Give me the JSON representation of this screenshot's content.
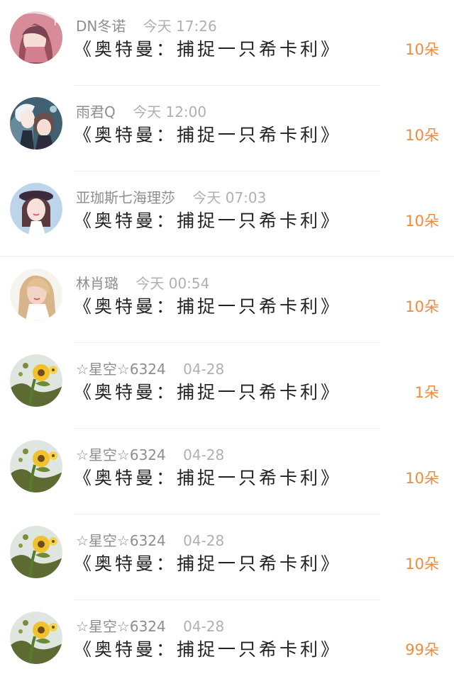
{
  "gift_list": [
    {
      "username": "DN冬诺",
      "time": "今天 17:26",
      "gift": "《奥特曼：捕捉一只希卡利》",
      "amount": "10朵",
      "avatar": "red-hood-girl-avatar"
    },
    {
      "username": "雨君Q",
      "time": "今天 12:00",
      "gift": "《奥特曼：捕捉一只希卡利》",
      "amount": "10朵",
      "avatar": "anime-characters-avatar"
    },
    {
      "username": "亚珈斯七海理莎",
      "time": "今天 07:03",
      "gift": "《奥特曼：捕捉一只希卡利》",
      "amount": "10朵",
      "avatar": "beret-girl-avatar"
    },
    {
      "username": "林肖璐",
      "time": "今天 00:54",
      "gift": "《奥特曼：捕捉一只希卡利》",
      "amount": "10朵",
      "avatar": "blonde-woman-avatar"
    },
    {
      "username": "☆星空☆6324",
      "time": "04-28",
      "gift": "《奥特曼：捕捉一只希卡利》",
      "amount": "1朵",
      "avatar": "sunflower-avatar"
    },
    {
      "username": "☆星空☆6324",
      "time": "04-28",
      "gift": "《奥特曼：捕捉一只希卡利》",
      "amount": "10朵",
      "avatar": "sunflower-avatar"
    },
    {
      "username": "☆星空☆6324",
      "time": "04-28",
      "gift": "《奥特曼：捕捉一只希卡利》",
      "amount": "10朵",
      "avatar": "sunflower-avatar"
    },
    {
      "username": "☆星空☆6324",
      "time": "04-28",
      "gift": "《奥特曼：捕捉一只希卡利》",
      "amount": "99朵",
      "avatar": "sunflower-avatar"
    }
  ],
  "colors": {
    "accent": "#f08b3c",
    "username": "#8e8e8e",
    "time": "#b0b0b0",
    "gift_text": "#222222",
    "divider": "#f0f0f0"
  }
}
